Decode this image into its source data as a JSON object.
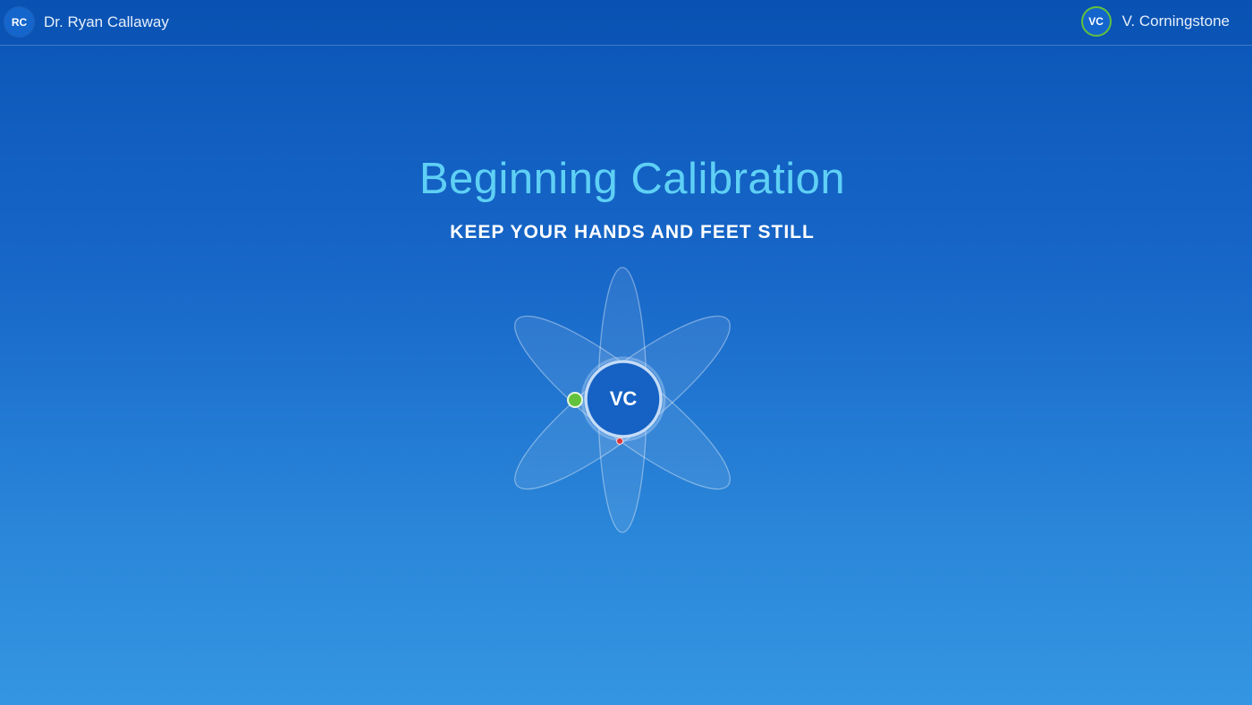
{
  "header": {
    "host": {
      "initials": "RC",
      "name": "Dr. Ryan Callaway"
    },
    "patient": {
      "initials": "VC",
      "name": "V. Corningstone",
      "status_color": "#63c13c"
    }
  },
  "main": {
    "title": "Beginning Calibration",
    "subtitle": "KEEP YOUR HANDS AND FEET STILL",
    "center_initials": "VC"
  },
  "theme": {
    "background_top": "#0a55b7",
    "background_bottom": "#3496e2",
    "title_color": "#5fd0f5",
    "accent_green": "#63c13c",
    "marker_red": "#d8343c"
  },
  "icons": {
    "calibration": "atom-orbit-icon",
    "tracking_point": "green-dot-icon",
    "reference_point": "red-dot-icon"
  }
}
